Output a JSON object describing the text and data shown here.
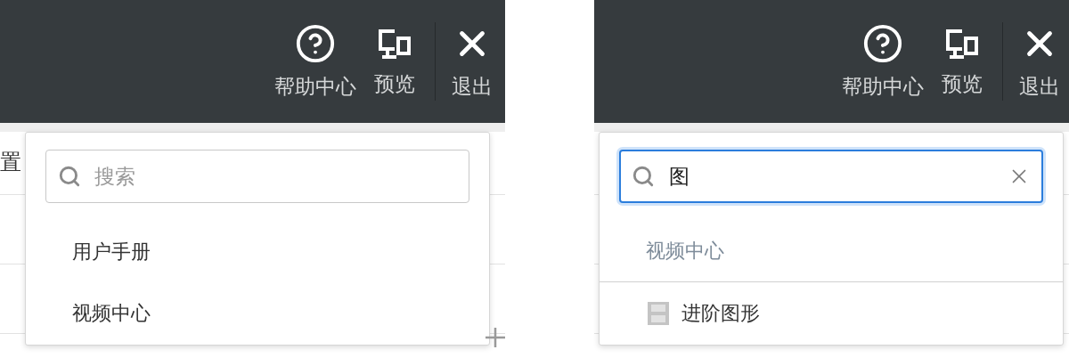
{
  "panels": [
    {
      "header": {
        "actions": [
          {
            "kind": "help",
            "label": "帮助中心"
          },
          {
            "kind": "preview",
            "label": "预览"
          },
          {
            "kind": "exit",
            "label": "退出"
          }
        ]
      },
      "canvas": {
        "side_text": "置"
      },
      "dropdown": {
        "search": {
          "placeholder": "搜索",
          "focused": false
        },
        "items": [
          {
            "kind": "link",
            "label": "用户手册"
          },
          {
            "kind": "link",
            "label": "视频中心"
          }
        ]
      }
    },
    {
      "header": {
        "actions": [
          {
            "kind": "help",
            "label": "帮助中心"
          },
          {
            "kind": "preview",
            "label": "预览"
          },
          {
            "kind": "exit",
            "label": "退出"
          }
        ]
      },
      "dropdown": {
        "search": {
          "value": "图",
          "focused": true
        },
        "items": [
          {
            "kind": "group",
            "label": "视频中心"
          },
          {
            "kind": "video",
            "label": "进阶图形"
          }
        ]
      }
    }
  ]
}
